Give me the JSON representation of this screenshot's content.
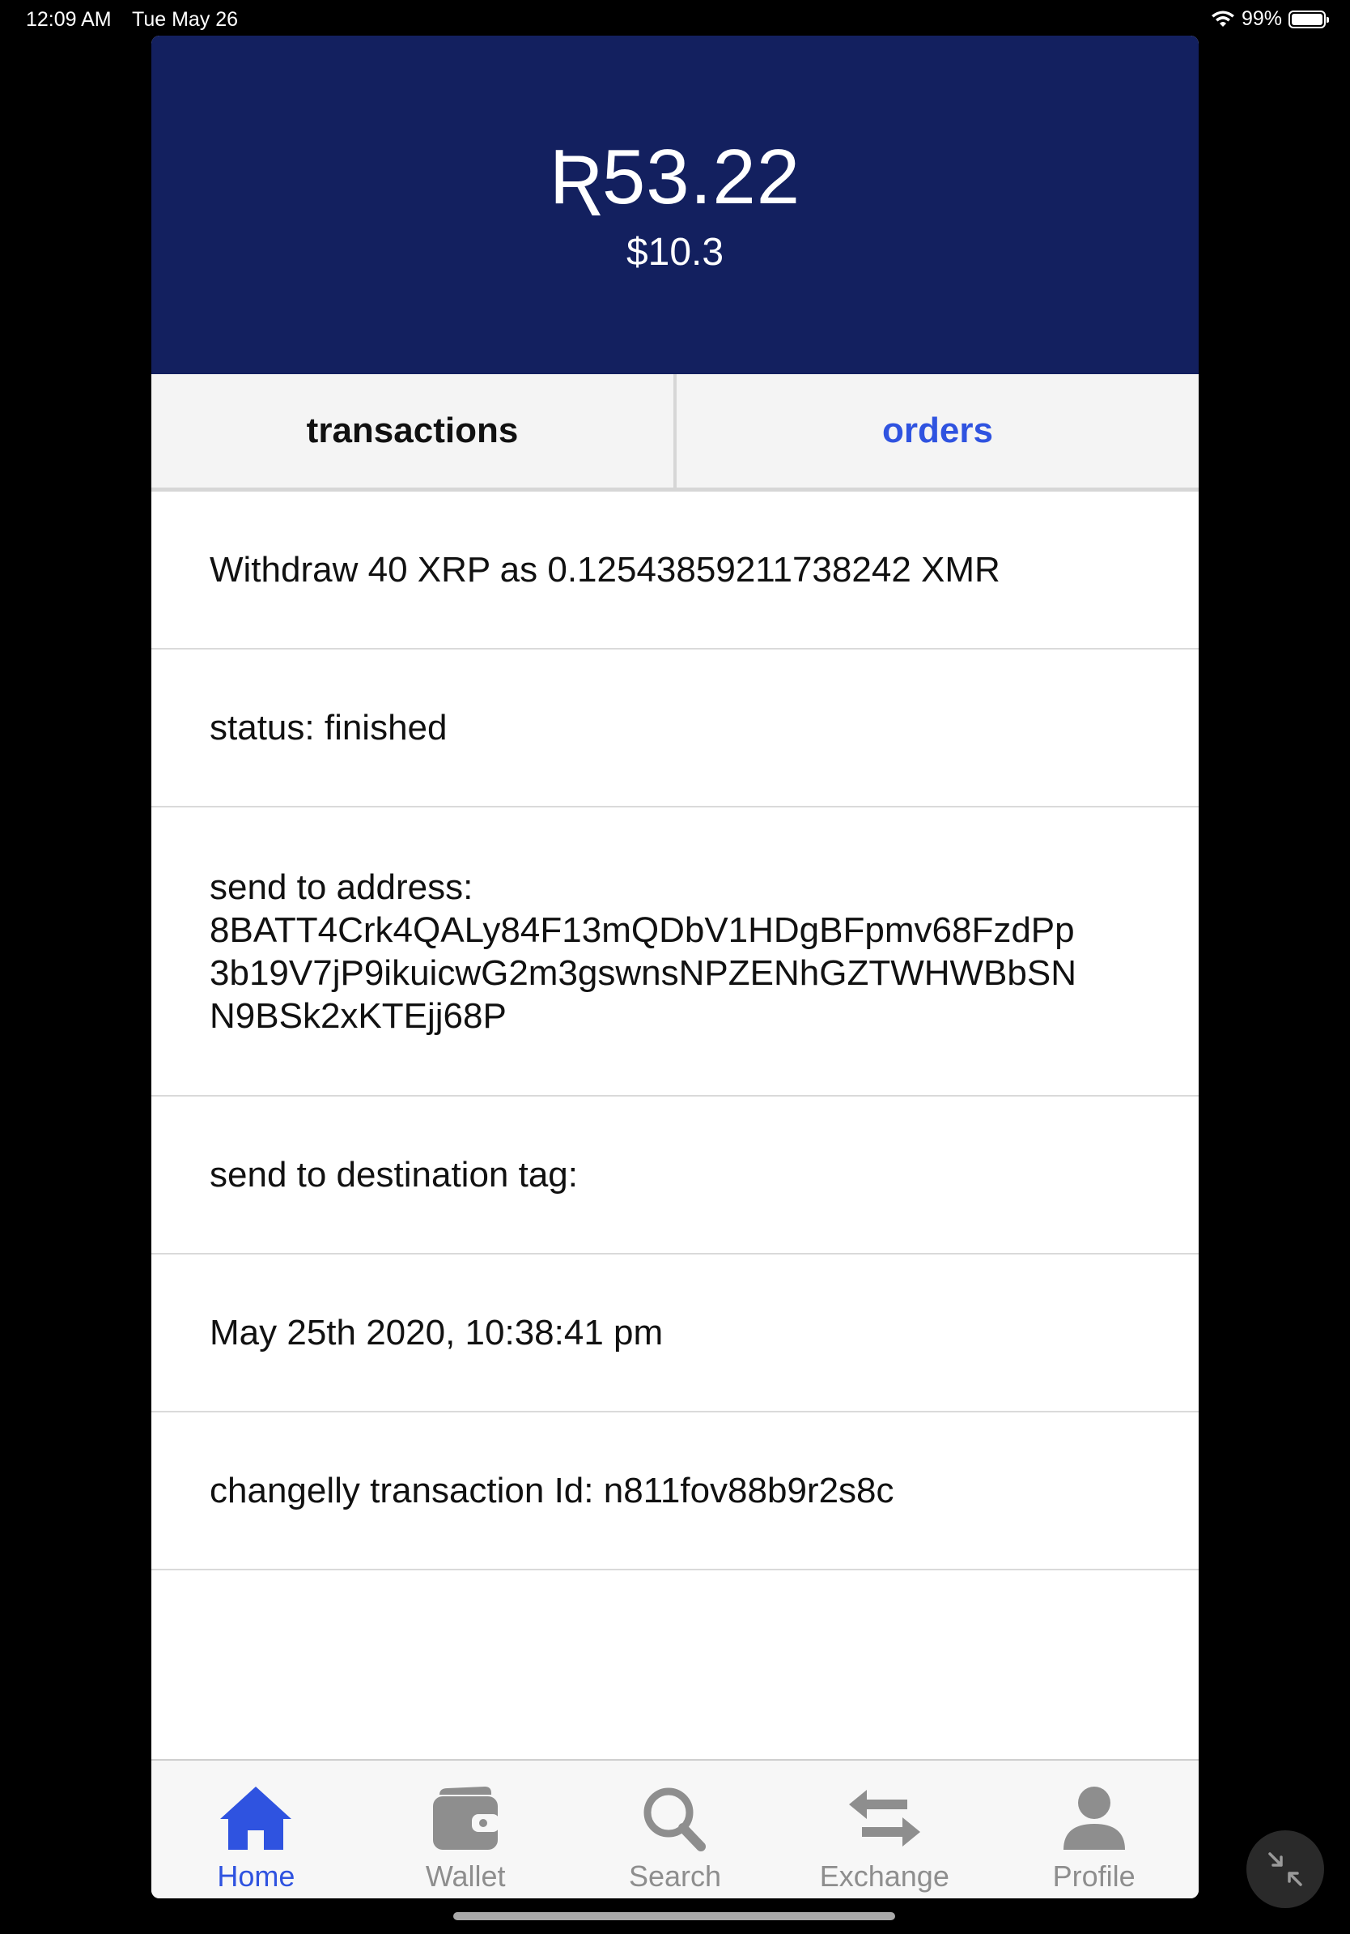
{
  "status_bar": {
    "time": "12:09 AM",
    "date": "Tue May 26",
    "battery": "99%"
  },
  "header": {
    "balance": "Ʀ53.22",
    "balance_usd": "$10.3"
  },
  "tabs": [
    {
      "label": "transactions"
    },
    {
      "label": "orders"
    }
  ],
  "transaction": {
    "title": "Withdraw 40 XRP as 0.12543859211738242 XMR",
    "status": "status:  finished",
    "address_label": "send to address:",
    "address_lines": [
      "8BATT4Crk4QALy84F13mQDbV1HDgBFpmv68FzdPp",
      "3b19V7jP9ikuicwG2m3gswnsNPZENhGZTWHWBbSN",
      "N9BSk2xKTEjj68P"
    ],
    "destination_tag": "send to destination tag:",
    "date": "May 25th 2020, 10:38:41 pm",
    "changelly_id": "changelly transaction Id:  n811fov88b9r2s8c"
  },
  "tabbar": {
    "items": [
      {
        "label": "Home",
        "icon": "home-icon",
        "active": true
      },
      {
        "label": "Wallet",
        "icon": "wallet-icon"
      },
      {
        "label": "Search",
        "icon": "search-icon"
      },
      {
        "label": "Exchange",
        "icon": "exchange-icon"
      },
      {
        "label": "Profile",
        "icon": "profile-icon"
      }
    ]
  },
  "colors": {
    "header_bg": "#13205f",
    "accent": "#2f53e0",
    "inactive": "#8e8e8e"
  }
}
